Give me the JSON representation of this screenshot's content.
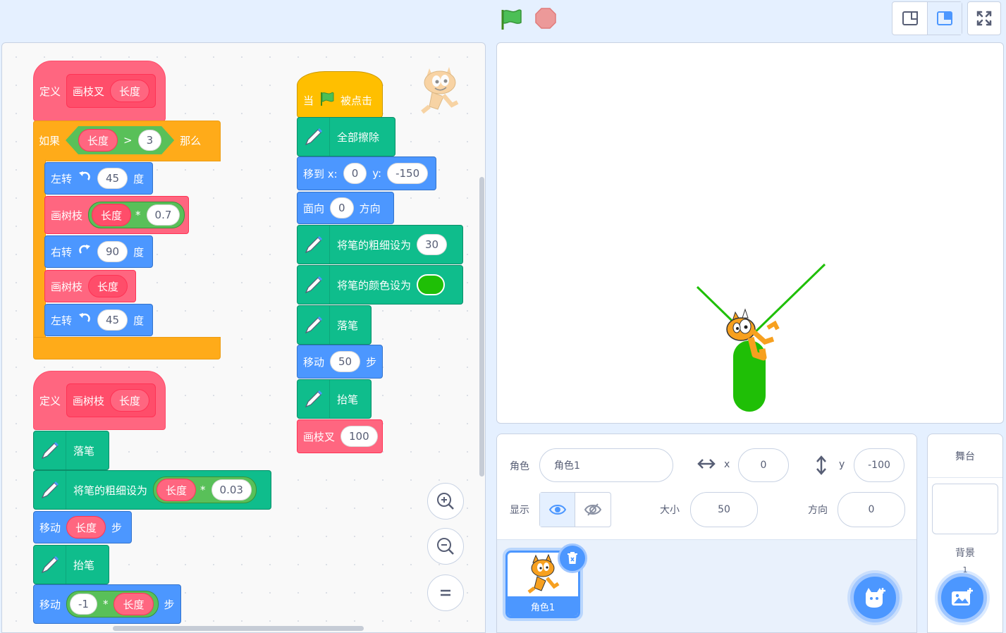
{
  "toolbar": {
    "green_flag_icon": "green-flag-icon",
    "stop_icon": "stop-icon",
    "small_stage_icon": "small-stage-icon",
    "normal_stage_icon": "normal-stage-icon",
    "fullscreen_icon": "fullscreen-icon"
  },
  "colors": {
    "accent": "#4c97ff",
    "custom_block": "#ff6680",
    "control": "#ffab19",
    "motion": "#4c97ff",
    "pen": "#0fbd8c",
    "event": "#ffbf00",
    "operator": "#59c059",
    "pen_color": "#1fbf06"
  },
  "scripts": {
    "define1": {
      "kw": "定义",
      "proc": "画枝叉",
      "param": "长度"
    },
    "if_block": {
      "kw_if": "如果",
      "param": "长度",
      "op": ">",
      "value": "3",
      "kw_then": "那么"
    },
    "turn_left_1": {
      "label": "左转",
      "value": "45",
      "unit": "度"
    },
    "draw_branch_1": {
      "label": "画树枝",
      "param": "长度",
      "op": "*",
      "value": "0.7"
    },
    "turn_right": {
      "label": "右转",
      "value": "90",
      "unit": "度"
    },
    "draw_branch_2": {
      "label": "画树枝",
      "param": "长度"
    },
    "turn_left_2": {
      "label": "左转",
      "value": "45",
      "unit": "度"
    },
    "define2": {
      "kw": "定义",
      "proc": "画树枝",
      "param": "长度"
    },
    "pen_down_1": {
      "label": "落笔"
    },
    "set_size_1": {
      "label": "将笔的粗细设为",
      "param": "长度",
      "op": "*",
      "value": "0.03"
    },
    "move_1": {
      "label": "移动",
      "param": "长度",
      "unit": "步"
    },
    "pen_up_1": {
      "label": "抬笔"
    },
    "move_2": {
      "label": "移动",
      "value": "-1",
      "op": "*",
      "param": "长度",
      "unit": "步"
    },
    "when_flag": {
      "prefix": "当",
      "suffix": "被点击"
    },
    "erase_all": {
      "label": "全部擦除"
    },
    "goto": {
      "label": "移到 x:",
      "x": "0",
      "ylabel": "y:",
      "y": "-150"
    },
    "point_dir": {
      "label": "面向",
      "value": "0",
      "unit": "方向"
    },
    "set_size_2": {
      "label": "将笔的粗细设为",
      "value": "30"
    },
    "set_color": {
      "label": "将笔的颜色设为"
    },
    "pen_down_2": {
      "label": "落笔"
    },
    "move_3": {
      "label": "移动",
      "value": "50",
      "unit": "步"
    },
    "pen_up_2": {
      "label": "抬笔"
    },
    "call_fork": {
      "label": "画枝叉",
      "value": "100"
    }
  },
  "sprite_info": {
    "sprite_label": "角色",
    "sprite_name": "角色1",
    "x_label": "x",
    "x": "0",
    "y_label": "y",
    "y": "-100",
    "show_label": "显示",
    "size_label": "大小",
    "size": "50",
    "direction_label": "方向",
    "direction": "0"
  },
  "sprites": [
    {
      "name": "角色1"
    }
  ],
  "stage_pane": {
    "title": "舞台",
    "backdrop_label": "背景",
    "backdrop_count": "1"
  }
}
